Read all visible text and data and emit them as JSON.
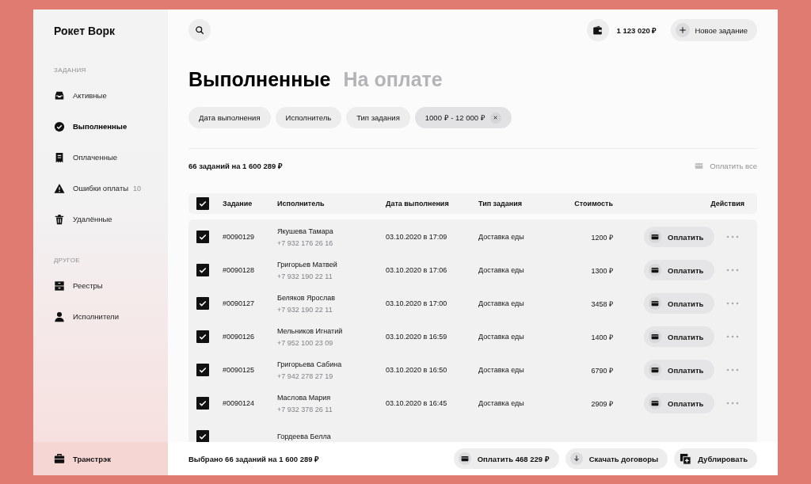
{
  "app": {
    "title": "Рокет Ворк"
  },
  "sidebar": {
    "sections": [
      {
        "heading": "ЗАДАНИЯ",
        "items": [
          {
            "label": "Активные",
            "selected": false
          },
          {
            "label": "Выполненные",
            "selected": true
          },
          {
            "label": "Оплаченные",
            "selected": false
          },
          {
            "label": "Ошибки оплаты",
            "selected": false,
            "count": "10"
          },
          {
            "label": "Удалённые",
            "selected": false
          }
        ]
      },
      {
        "heading": "ДРУГОЕ",
        "items": [
          {
            "label": "Реестры",
            "selected": false
          },
          {
            "label": "Исполнители",
            "selected": false
          }
        ]
      }
    ],
    "footer": {
      "label": "Транстрэк"
    }
  },
  "top_bar": {
    "balance": "1 123 020 ₽",
    "new_button": "Новое задание"
  },
  "tabs": [
    {
      "label": "Выполненные",
      "selected": true
    },
    {
      "label": "На оплате",
      "selected": false
    }
  ],
  "filters": [
    {
      "label": "Дата выполнения",
      "active": false
    },
    {
      "label": "Исполнитель",
      "active": false
    },
    {
      "label": "Тип задания",
      "active": false
    },
    {
      "label": "1000 ₽ - 12 000 ₽",
      "active": true
    }
  ],
  "summary": {
    "text": "66 заданий на 1 600 289 ₽",
    "pay_all": "Оплатить все",
    "pay_all_disabled": true
  },
  "table": {
    "header_checked": true,
    "columns": [
      "Задание",
      "Исполнитель",
      "Дата выполнения",
      "Тип задания",
      "Стоимость",
      "Действия"
    ],
    "rows": [
      {
        "checked": true,
        "id": "#0090129",
        "name": "Якушева Тамара",
        "phone": "+7 932 176 26 16",
        "date": "03.10.2020 в 17:09",
        "type": "Доставка еды",
        "cost": "1200 ₽",
        "action": "Оплатить"
      },
      {
        "checked": true,
        "id": "#0090128",
        "name": "Григорьев Матвей",
        "phone": "+7 932 190 22 11",
        "date": "03.10.2020 в 17:06",
        "type": "Доставка еды",
        "cost": "1300 ₽",
        "action": "Оплатить"
      },
      {
        "checked": true,
        "id": "#0090127",
        "name": "Беляков Ярослав",
        "phone": "+7 932 190 22 11",
        "date": "03.10.2020 в 17:00",
        "type": "Доставка еды",
        "cost": "3458 ₽",
        "action": "Оплатить"
      },
      {
        "checked": true,
        "id": "#0090126",
        "name": "Мельников Игнатий",
        "phone": "+7 952 100 23 09",
        "date": "03.10.2020 в 16:59",
        "type": "Доставка еды",
        "cost": "1400 ₽",
        "action": "Оплатить"
      },
      {
        "checked": true,
        "id": "#0090125",
        "name": "Григорьева Сабина",
        "phone": "+7 942 278 27 19",
        "date": "03.10.2020 в 16:50",
        "type": "Доставка еды",
        "cost": "6790 ₽",
        "action": "Оплатить"
      },
      {
        "checked": true,
        "id": "#0090124",
        "name": "Маслова Мария",
        "phone": "+7 932 378 26 11",
        "date": "03.10.2020 в 16:45",
        "type": "Доставка еды",
        "cost": "2909 ₽",
        "action": "Оплатить"
      },
      {
        "checked": true,
        "name": "Гордеева Белла"
      }
    ]
  },
  "bottom_bar": {
    "selection": "Выбрано 66 заданий на 1 600 289 ₽",
    "buttons": [
      {
        "label": "Оплатить 468 229 ₽"
      },
      {
        "label": "Скачать договоры"
      },
      {
        "label": "Дублировать"
      }
    ]
  }
}
